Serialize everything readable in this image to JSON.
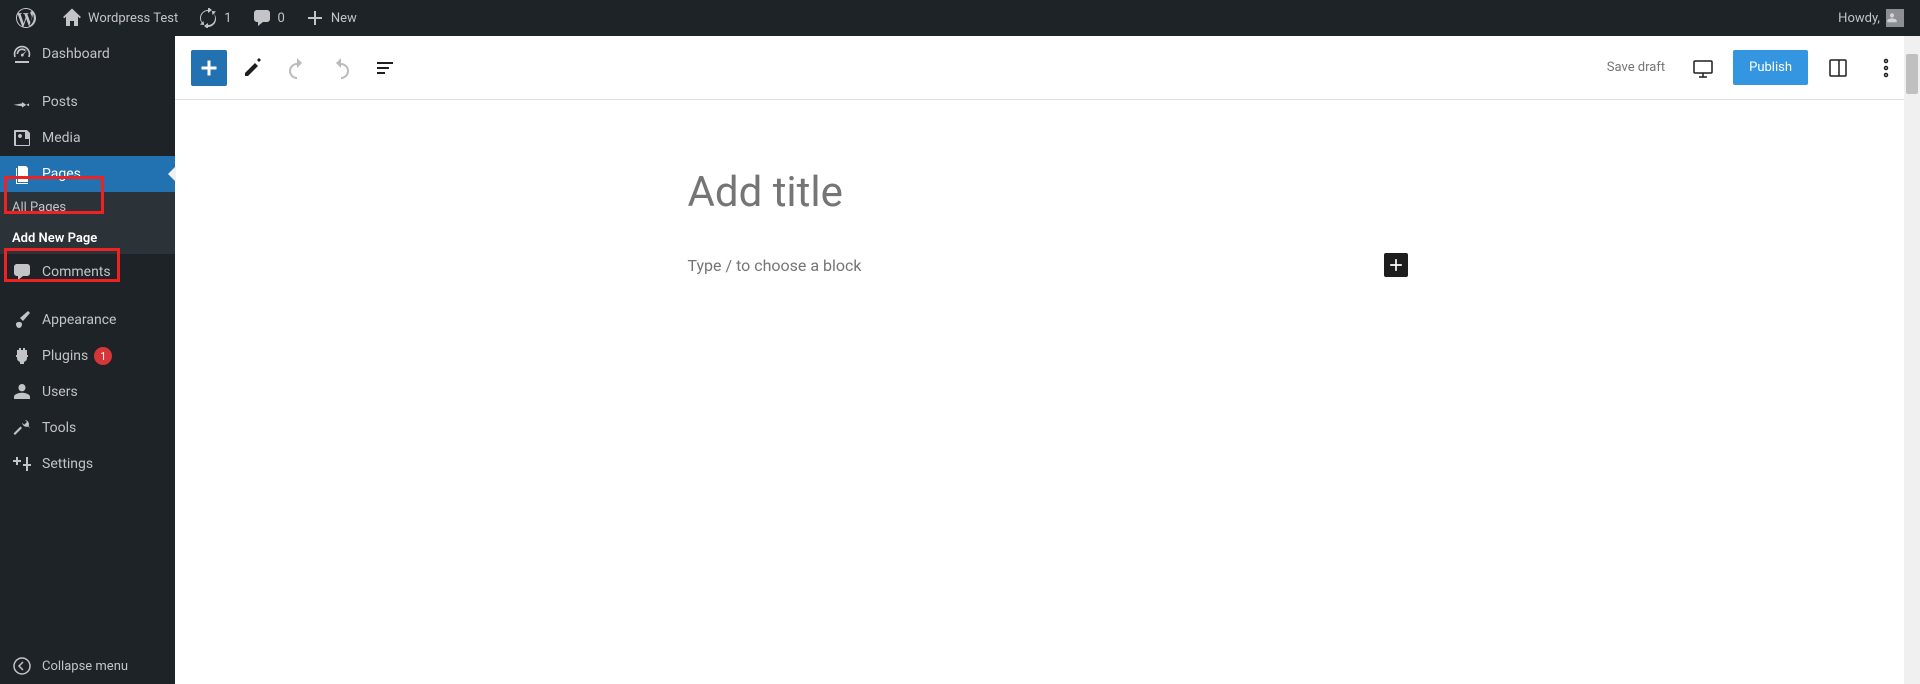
{
  "adminbar": {
    "site_name": "Wordpress Test",
    "updates_count": "1",
    "comments_count": "0",
    "new_label": "New",
    "howdy_prefix": "Howdy, ",
    "user_name": ""
  },
  "sidebar": {
    "dashboard": "Dashboard",
    "posts": "Posts",
    "media": "Media",
    "pages": "Pages",
    "pages_sub_all": "All Pages",
    "pages_sub_add": "Add New Page",
    "comments": "Comments",
    "appearance": "Appearance",
    "plugins": "Plugins",
    "plugins_badge": "1",
    "users": "Users",
    "tools": "Tools",
    "settings": "Settings",
    "collapse": "Collapse menu"
  },
  "toolbar": {
    "save_draft": "Save draft",
    "publish": "Publish"
  },
  "editor": {
    "title_placeholder": "Add title",
    "block_placeholder": "Type / to choose a block"
  }
}
